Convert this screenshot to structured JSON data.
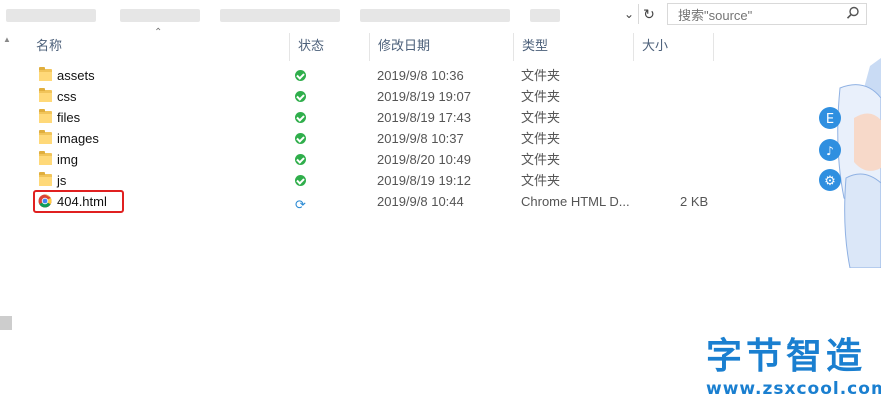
{
  "search": {
    "placeholder": "搜索\"source\""
  },
  "columns": {
    "name": "名称",
    "status": "状态",
    "modified": "修改日期",
    "type": "类型",
    "size": "大小"
  },
  "files": [
    {
      "name": "assets",
      "kind": "folder",
      "status": "ok",
      "date": "2019/9/8 10:36",
      "type": "文件夹",
      "size": ""
    },
    {
      "name": "css",
      "kind": "folder",
      "status": "ok",
      "date": "2019/8/19 19:07",
      "type": "文件夹",
      "size": ""
    },
    {
      "name": "files",
      "kind": "folder",
      "status": "ok",
      "date": "2019/8/19 17:43",
      "type": "文件夹",
      "size": ""
    },
    {
      "name": "images",
      "kind": "folder",
      "status": "ok",
      "date": "2019/9/8 10:37",
      "type": "文件夹",
      "size": ""
    },
    {
      "name": "img",
      "kind": "folder",
      "status": "ok",
      "date": "2019/8/20 10:49",
      "type": "文件夹",
      "size": ""
    },
    {
      "name": "js",
      "kind": "folder",
      "status": "ok",
      "date": "2019/8/19 19:12",
      "type": "文件夹",
      "size": ""
    },
    {
      "name": "404.html",
      "kind": "chrome-html",
      "status": "sync",
      "date": "2019/9/8 10:44",
      "type": "Chrome HTML D...",
      "size": "2 KB"
    }
  ],
  "colors": {
    "folder": "#f1c45a",
    "status_ok": "#2fae4b",
    "sync": "#2a8ad4",
    "highlight": "#e02020",
    "watermark": "#1a7fd0"
  },
  "watermark": {
    "title": "字节智造",
    "url": "www.zsxcool.com"
  },
  "mascot_badges": [
    "E",
    "♪",
    "⚙"
  ]
}
